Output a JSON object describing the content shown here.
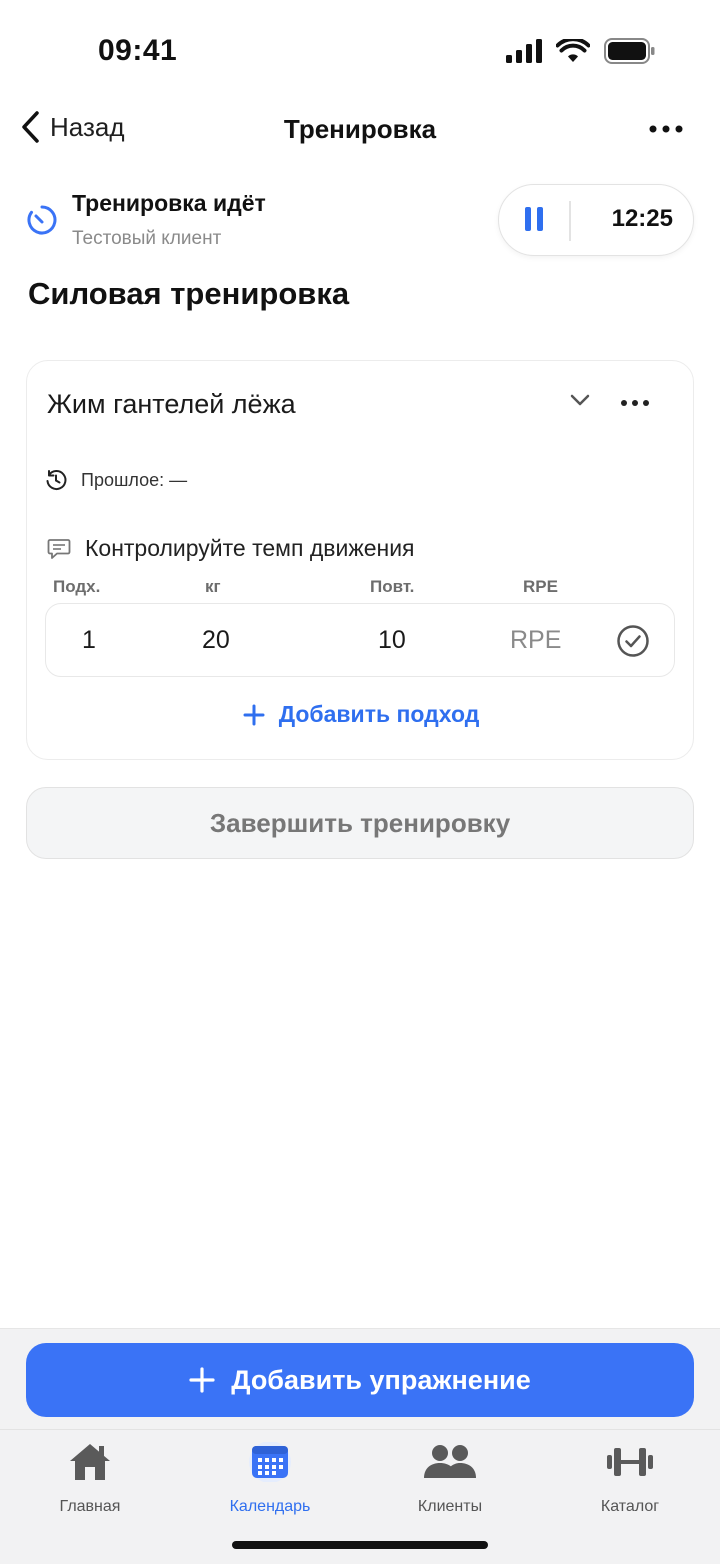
{
  "status_bar": {
    "time": "09:41"
  },
  "nav": {
    "back_label": "Назад",
    "title": "Тренировка"
  },
  "session": {
    "status": "Тренировка идёт",
    "client": "Тестовый клиент",
    "timer": "12:25"
  },
  "workout_title": "Силовая тренировка",
  "exercise": {
    "name": "Жим гантелей лёжа",
    "history": "Прошлое: —",
    "note": "Контролируйте темп движения",
    "columns": {
      "set": "Подх.",
      "weight": "кг",
      "reps": "Повт.",
      "rpe": "RPE"
    },
    "sets": [
      {
        "set": "1",
        "weight": "20",
        "reps": "10",
        "rpe": "RPE"
      }
    ],
    "add_set_label": "Добавить подход"
  },
  "finish_label": "Завершить тренировку",
  "add_exercise_label": "Добавить упражнение",
  "tabs": [
    {
      "label": "Главная",
      "icon": "home-icon"
    },
    {
      "label": "Календарь",
      "icon": "calendar-icon"
    },
    {
      "label": "Клиенты",
      "icon": "people-icon"
    },
    {
      "label": "Каталог",
      "icon": "dumbbell-icon"
    }
  ],
  "colors": {
    "accent": "#2f6fef",
    "primary_button": "#3a73f6",
    "muted": "#8a8a8a"
  }
}
